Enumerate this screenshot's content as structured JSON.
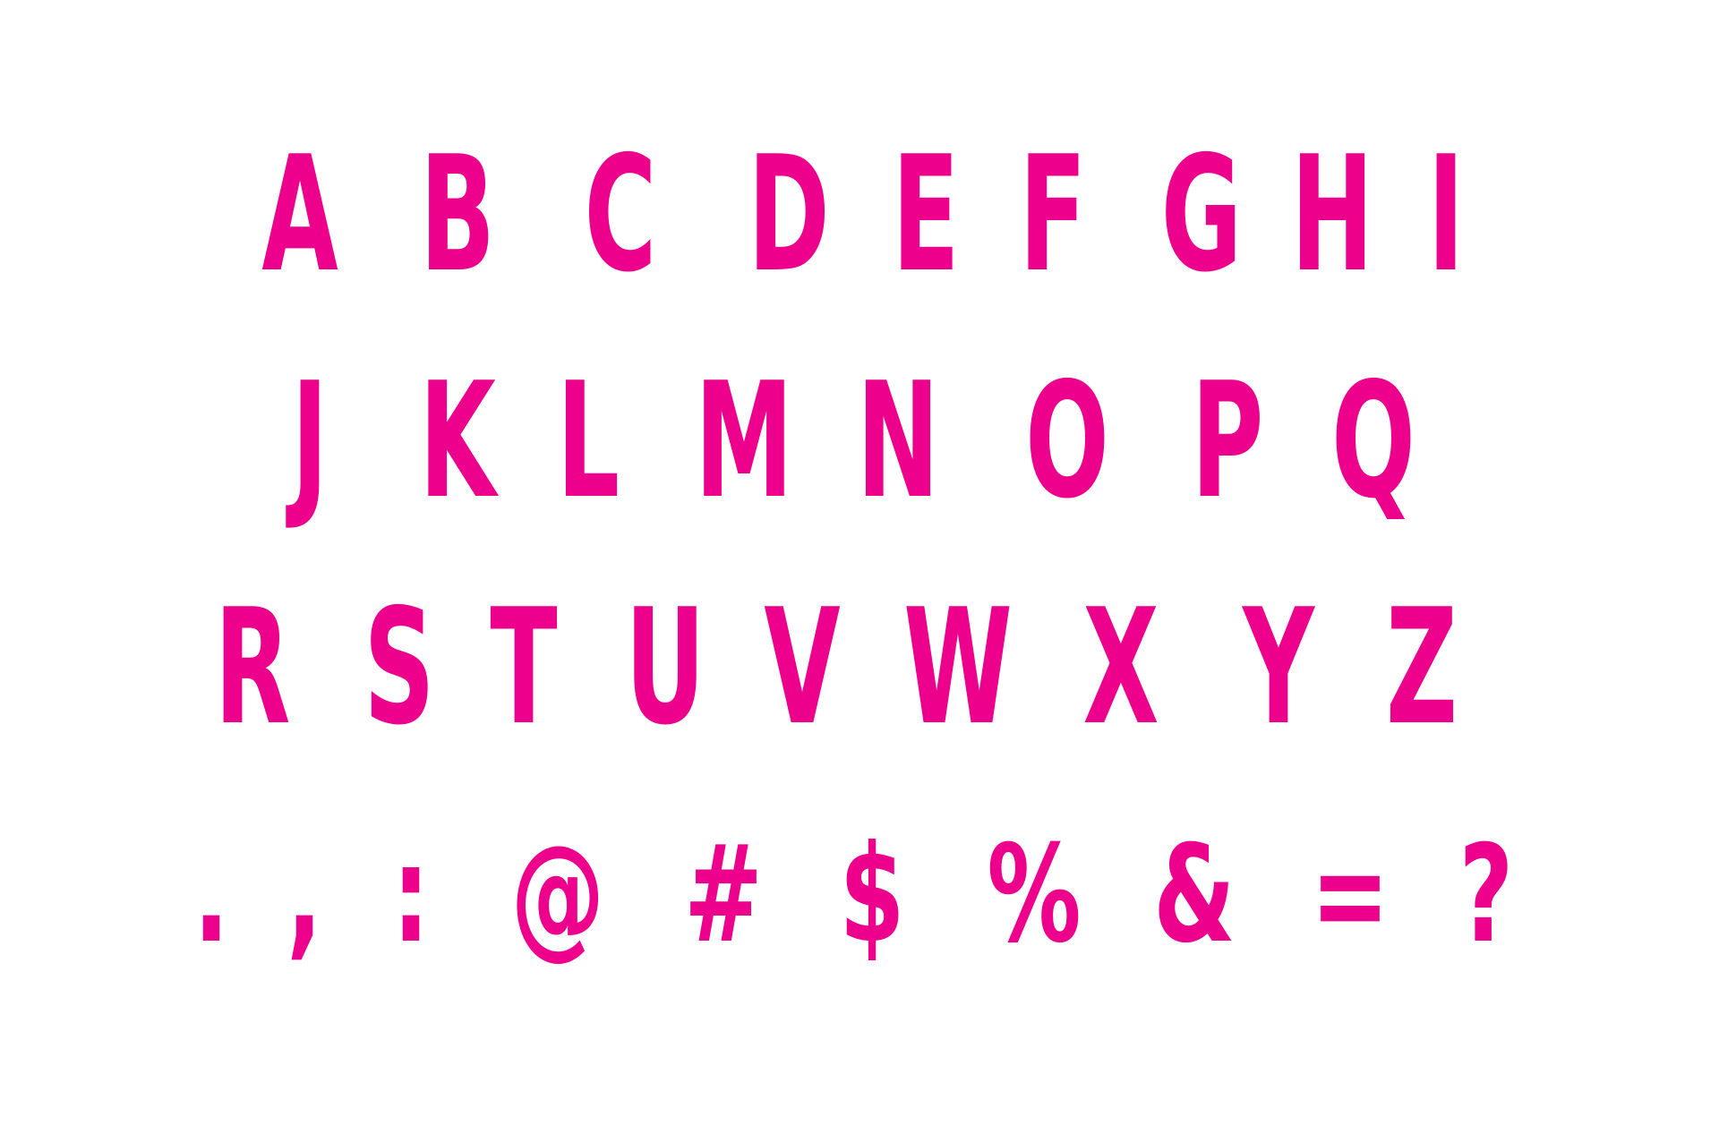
{
  "accent_color": "#ec008c",
  "rows": [
    [
      "A",
      "B",
      "C",
      "D",
      "E",
      "F",
      "G",
      "H",
      "I"
    ],
    [
      "J",
      "K",
      "L",
      "M",
      "N",
      "O",
      "P",
      "Q"
    ],
    [
      "R",
      "S",
      "T",
      "U",
      "V",
      "W",
      "X",
      "Y",
      "Z"
    ],
    [
      ".",
      ",",
      ":",
      "@",
      "#",
      "$",
      "%",
      "&",
      "=",
      "?"
    ]
  ]
}
